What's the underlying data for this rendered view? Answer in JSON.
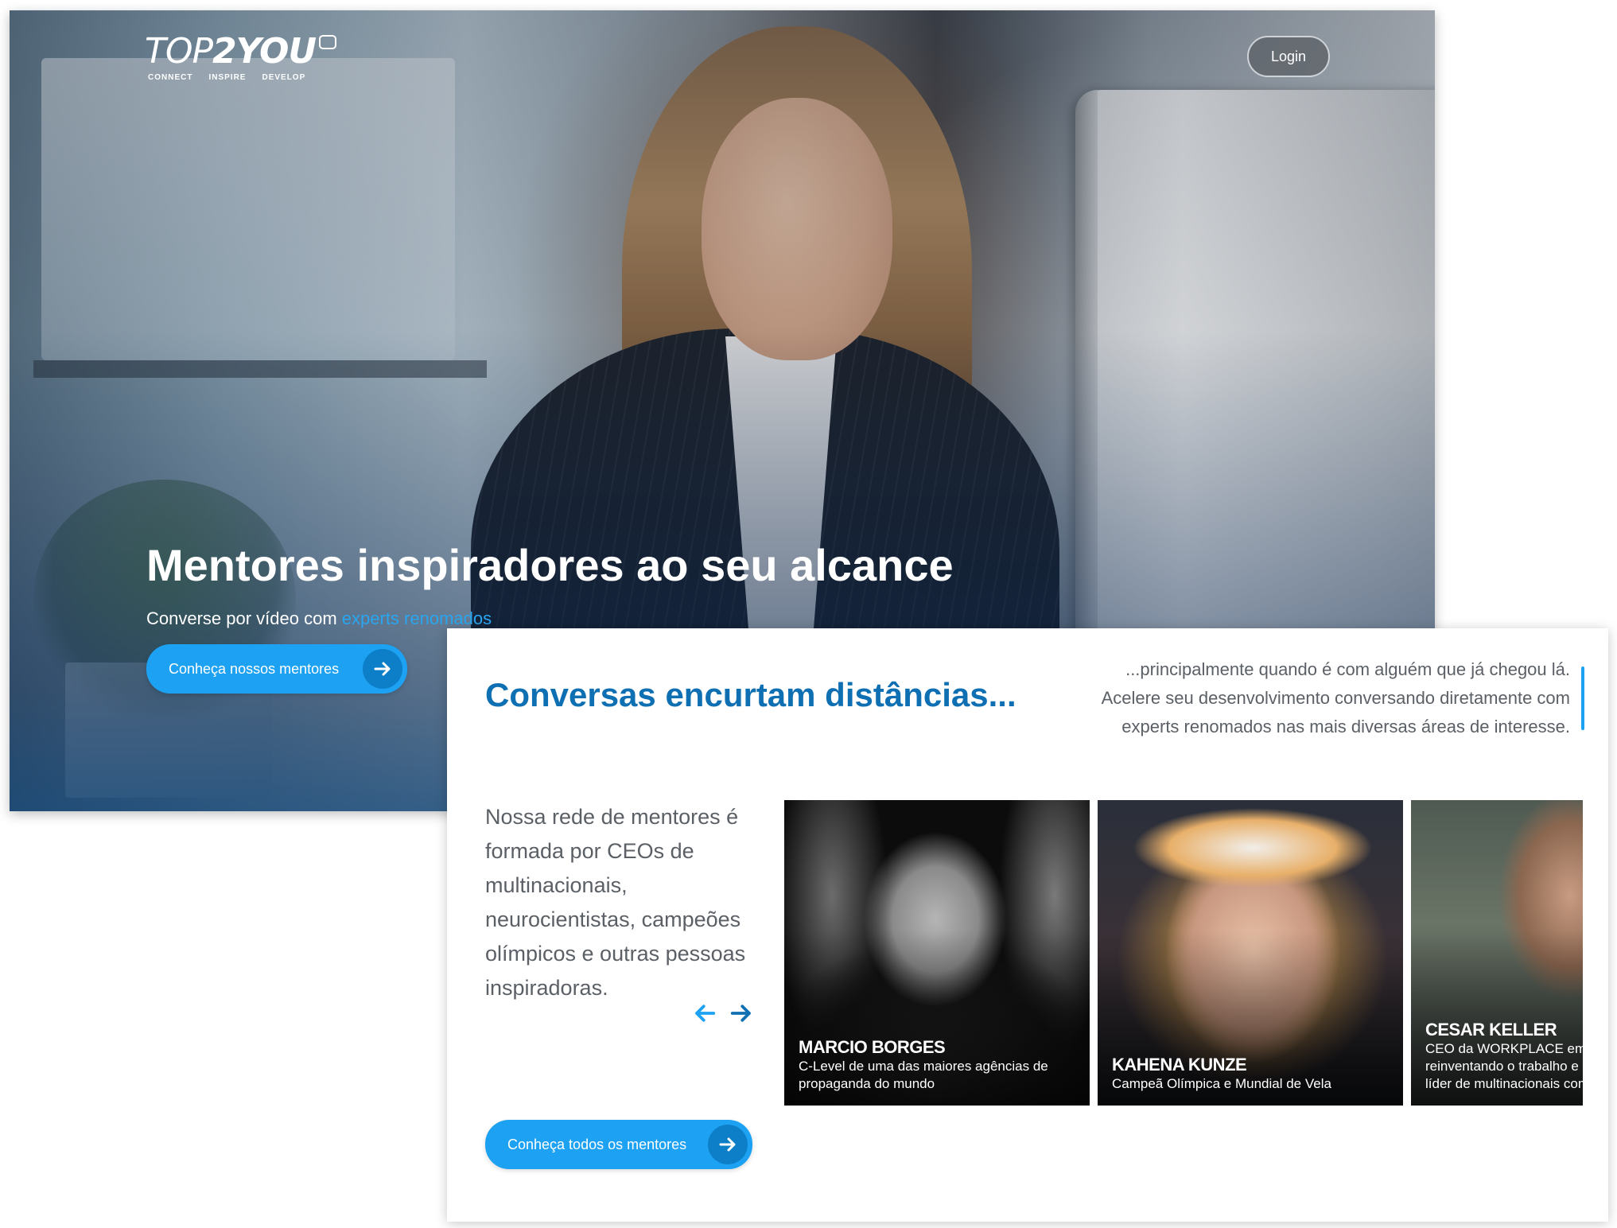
{
  "colors": {
    "brand_blue": "#1da1f2",
    "title_blue": "#0f6fb3",
    "text_gray": "#5b6066",
    "highlight": "#2aa6f0"
  },
  "hero": {
    "logo": {
      "top": "TOP",
      "two_you": "2YOU",
      "tagline_1": "CONNECT",
      "tagline_2": "INSPIRE",
      "tagline_3": "DEVELOP"
    },
    "login_label": "Login",
    "title": "Mentores inspiradores ao seu alcance",
    "subtitle_prefix": "Converse por vídeo com ",
    "subtitle_highlight": "experts renomados",
    "cta_label": "Conheça nossos mentores",
    "cta_icon": "arrow-right-icon"
  },
  "section": {
    "title": "Conversas encurtam distâncias...",
    "intro_line_1": "...principalmente quando é com alguém que já chegou lá.",
    "intro_line_2": "Acelere seu desenvolvimento conversando diretamente com",
    "intro_line_3": "experts renomados nas mais diversas áreas de interesse.",
    "description": "Nossa rede de mentores é formada por CEOs de multinacionais, neurocientistas, campeões olímpicos e outras pessoas inspiradoras.",
    "prev_icon": "arrow-left-icon",
    "next_icon": "arrow-right-icon",
    "cta_label": "Conheça todos os mentores"
  },
  "mentors": [
    {
      "name": "MARCIO BORGES",
      "role": "C-Level de uma das maiores agências de propaganda do mundo"
    },
    {
      "name": "KAHENA KUNZE",
      "role": "Campeã Olímpica e Mundial de Vela"
    },
    {
      "name": "CESAR KELLER",
      "role": "CEO da WORKPLACE em Seattle reinventando o trabalho e um reconhecido líder de multinacionais como Nokia"
    }
  ]
}
